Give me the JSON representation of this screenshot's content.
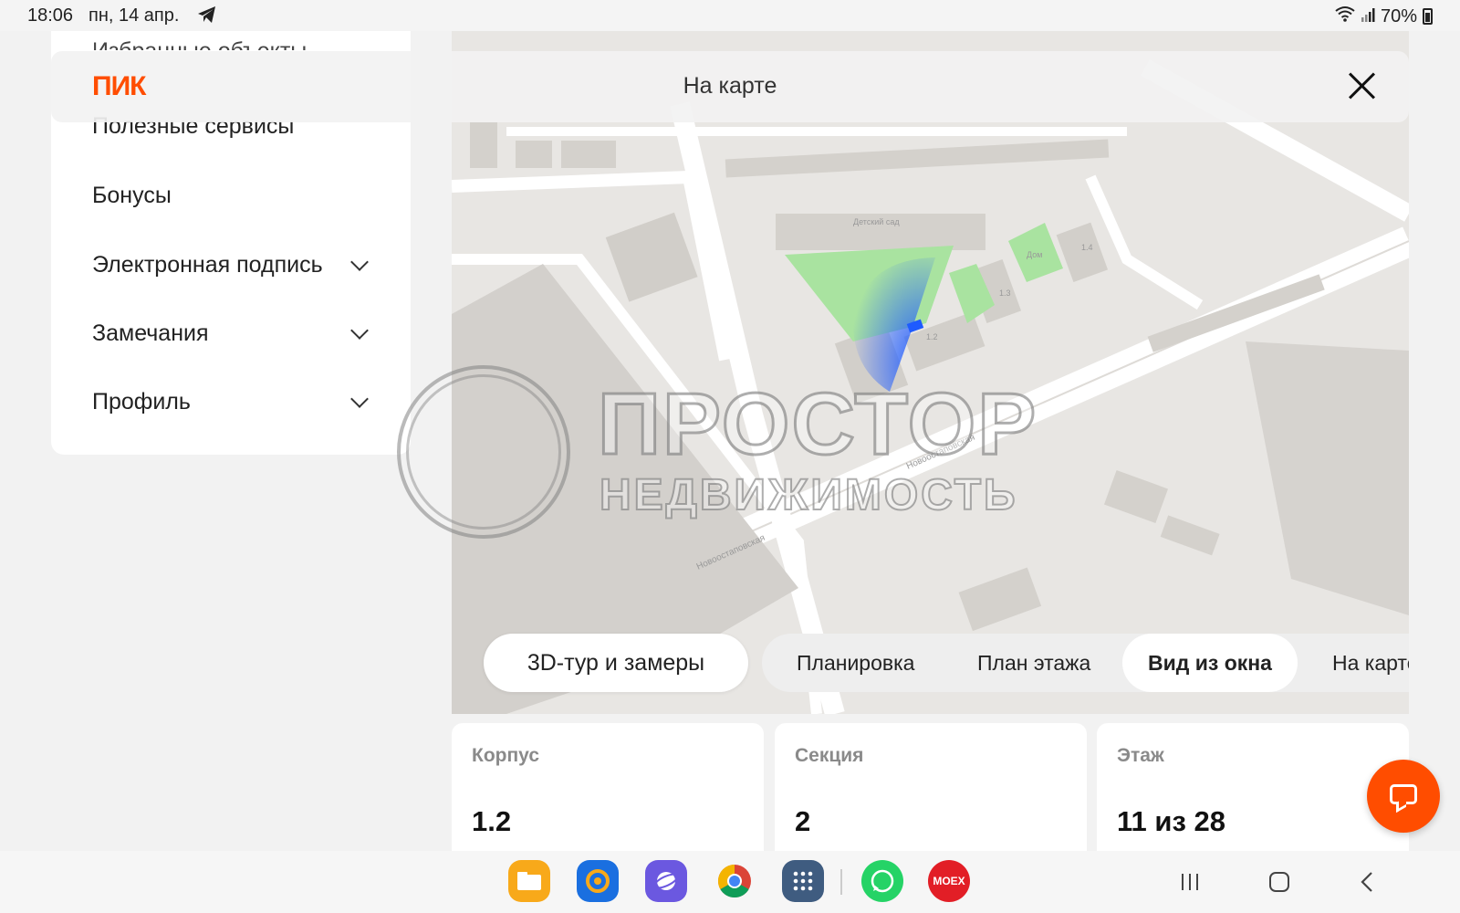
{
  "status_bar": {
    "time": "18:06",
    "date": "пн, 14 апр.",
    "battery": "70%"
  },
  "header": {
    "logo": "ПИК",
    "title": "На карте"
  },
  "sidebar": {
    "cut_item": "Избранные объекты",
    "items": [
      {
        "label": "Полезные сервисы"
      },
      {
        "label": "Бонусы"
      },
      {
        "label": "Электронная подпись"
      },
      {
        "label": "Замечания"
      },
      {
        "label": "Профиль"
      }
    ]
  },
  "map": {
    "labels": {
      "kindergarten": "Детский сад",
      "house": "Дом",
      "street1": "Новоостаповская",
      "street2": "Новоостаповская",
      "b12": "1.2",
      "b13": "1.3",
      "b14": "1.4"
    }
  },
  "watermark": {
    "line1": "ПРОСТОР",
    "line2": "НЕДВИЖИМОСТЬ"
  },
  "tabs": {
    "tour": "3D-тур и замеры",
    "items": [
      {
        "label": "Планировка"
      },
      {
        "label": "План этажа"
      },
      {
        "label": "Вид из окна"
      },
      {
        "label": "На карте"
      }
    ]
  },
  "cards": [
    {
      "label": "Корпус",
      "value": "1.2"
    },
    {
      "label": "Секция",
      "value": "2"
    },
    {
      "label": "Этаж",
      "value": "11 из 28"
    }
  ],
  "dock": {
    "moex_label": "MOEX"
  },
  "colors": {
    "brand": "#ff4d00",
    "view_cone": "#1e5bff",
    "park": "#a9e3a0"
  }
}
